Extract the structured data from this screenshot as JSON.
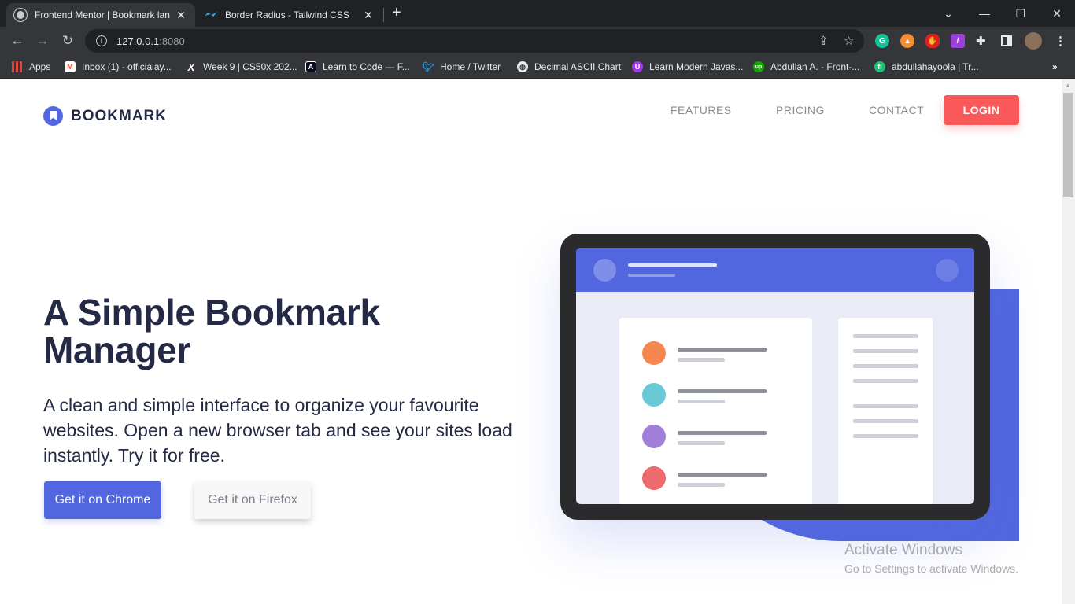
{
  "browser": {
    "tabs": [
      {
        "title": "Frontend Mentor | Bookmark lan",
        "active": true
      },
      {
        "title": "Border Radius - Tailwind CSS",
        "active": false
      }
    ],
    "address": {
      "host": "127.0.0.1",
      "port": ":8080"
    },
    "bookmarks": [
      {
        "label": "Apps",
        "icon": "apps-grid-icon"
      },
      {
        "label": "Inbox (1) - officialay...",
        "icon": "gmail-icon"
      },
      {
        "label": "Week 9 | CS50x 202...",
        "icon": "x-icon"
      },
      {
        "label": "Learn to Code — F...",
        "icon": "freecodecamp-icon"
      },
      {
        "label": "Home / Twitter",
        "icon": "twitter-icon"
      },
      {
        "label": "Decimal ASCII Chart",
        "icon": "globe-icon"
      },
      {
        "label": "Learn Modern Javas...",
        "icon": "udemy-icon"
      },
      {
        "label": "Abdullah A. - Front-...",
        "icon": "upwork-icon"
      },
      {
        "label": "abdullahayoola | Tr...",
        "icon": "fiverr-icon"
      }
    ]
  },
  "site": {
    "brand": "BOOKMARK",
    "nav": [
      "FEATURES",
      "PRICING",
      "CONTACT"
    ],
    "login": "LOGIN",
    "hero": {
      "title": "A Simple Bookmark Manager",
      "subtitle": "A clean and simple interface to organize your favourite websites. Open a new browser tab and see your sites load instantly. Try it for free.",
      "btn_chrome": "Get it on Chrome",
      "btn_firefox": "Get it on Firefox"
    },
    "illustration_dots": [
      "#f6874f",
      "#6ac9d7",
      "#a17fd8",
      "#ed6b6d"
    ],
    "accent": "#5267df",
    "danger": "#fa5959"
  },
  "watermark": {
    "line1": "Activate Windows",
    "line2": "Go to Settings to activate Windows."
  }
}
